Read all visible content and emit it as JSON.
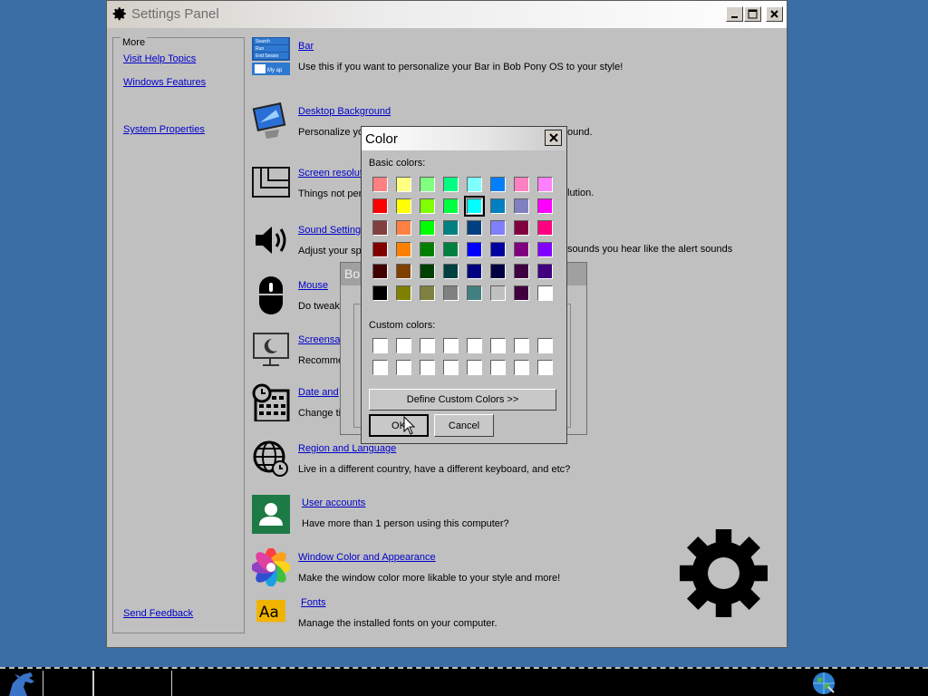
{
  "window": {
    "title": "Settings Panel"
  },
  "sidebar": {
    "legend": "More",
    "links": [
      {
        "label": "Visit Help Topics"
      },
      {
        "label": "Windows Features"
      },
      {
        "label": "System Properties"
      },
      {
        "label": "Send Feedback"
      }
    ]
  },
  "items": [
    {
      "title": "Bar",
      "desc": "Use this if you want to personalize your Bar in Bob Pony OS to your style!"
    },
    {
      "title": "Desktop Background",
      "desc": "Personalize yo"
    },
    {
      "title": "Screen resolut",
      "desc": "Things not per"
    },
    {
      "title": "Sound Settings",
      "desc": "Adjust your sp"
    },
    {
      "title": "Mouse",
      "desc": "Do tweak"
    },
    {
      "title": "Screensa",
      "desc": "Recomme"
    },
    {
      "title": "Date and",
      "desc": "Change ti"
    },
    {
      "title": "Region and Language",
      "desc": "Live in a different country, have a different keyboard, and etc?"
    },
    {
      "title": "User accounts",
      "desc": "Have more than 1 person using this computer?"
    },
    {
      "title": "Window Color and Appearance",
      "desc": "Make the window color more likable to your style and more!"
    },
    {
      "title": "Fonts",
      "desc": "Manage the installed fonts on your computer."
    }
  ],
  "peek_text": {
    "desktop": "ound.",
    "screen": "lution.",
    "sound": "sounds you hear like the alert sounds"
  },
  "bar_icon_text": {
    "line1": "Search",
    "line2": "Run",
    "line3": "End Sessio",
    "line4": "My ap"
  },
  "bg_dialog": {
    "title": "Bo"
  },
  "color_dialog": {
    "title": "Color",
    "basic_label": "Basic colors:",
    "custom_label": "Custom colors:",
    "define_button": "Define Custom Colors >>",
    "ok_button": "OK",
    "cancel_button": "Cancel",
    "basic_colors": [
      [
        "#ff8080",
        "#ffff80",
        "#80ff80",
        "#00ff80",
        "#80ffff",
        "#0080ff",
        "#ff80c0",
        "#ff80ff"
      ],
      [
        "#ff0000",
        "#ffff00",
        "#80ff00",
        "#00ff40",
        "#00ffff",
        "#0080c0",
        "#8080c0",
        "#ff00ff"
      ],
      [
        "#804040",
        "#ff8040",
        "#00ff00",
        "#008080",
        "#004080",
        "#8080ff",
        "#800040",
        "#ff0080"
      ],
      [
        "#800000",
        "#ff8000",
        "#008000",
        "#008040",
        "#0000ff",
        "#0000a0",
        "#800080",
        "#8000ff"
      ],
      [
        "#400000",
        "#804000",
        "#004000",
        "#004040",
        "#000080",
        "#000040",
        "#400040",
        "#400080"
      ],
      [
        "#000000",
        "#808000",
        "#808040",
        "#808080",
        "#408080",
        "#c0c0c0",
        "#400040",
        "#ffffff"
      ]
    ],
    "selected": {
      "row": 1,
      "col": 4
    },
    "custom_colors": [
      [
        "#ffffff",
        "#ffffff",
        "#ffffff",
        "#ffffff",
        "#ffffff",
        "#ffffff",
        "#ffffff",
        "#ffffff"
      ],
      [
        "#ffffff",
        "#ffffff",
        "#ffffff",
        "#ffffff",
        "#ffffff",
        "#ffffff",
        "#ffffff",
        "#ffffff"
      ]
    ]
  },
  "colors": {
    "desktop": "#3a6ea5",
    "window": "#c0c0c0",
    "link": "#0000cc",
    "taskbar": "#000000"
  }
}
